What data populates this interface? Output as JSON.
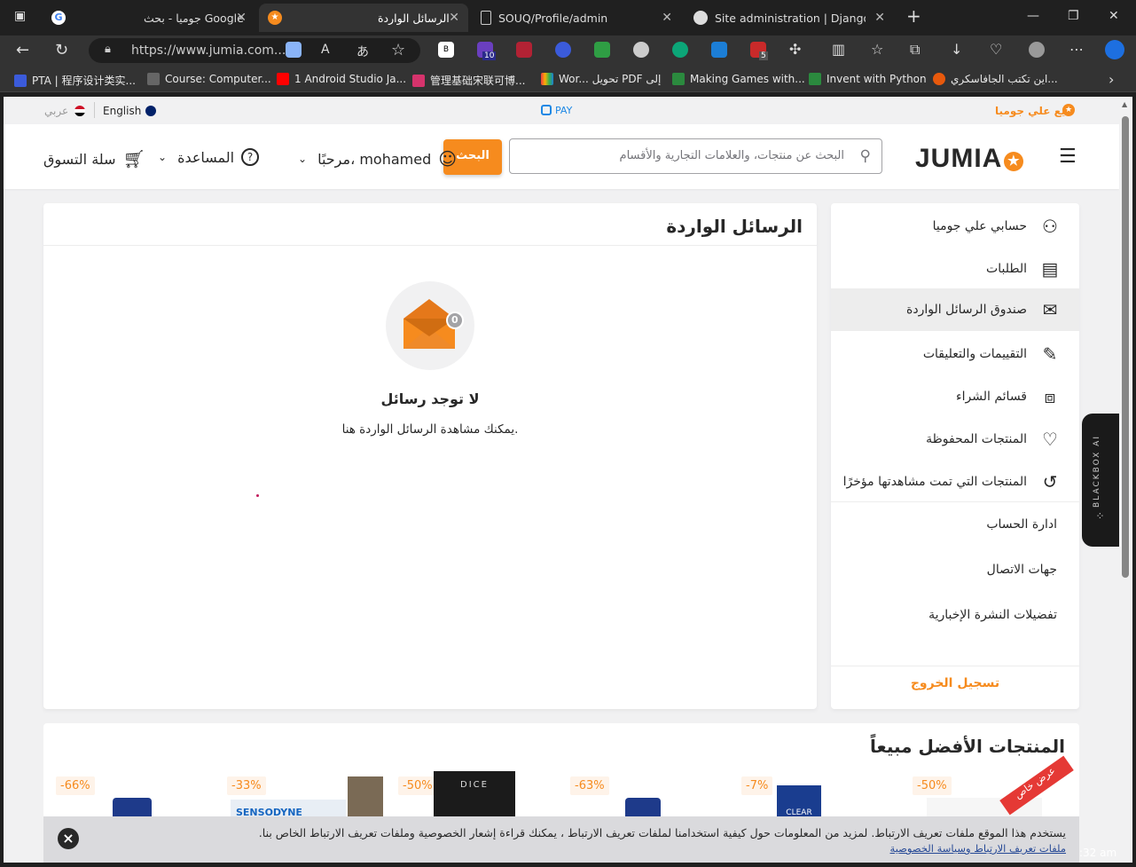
{
  "browser": {
    "tabs": [
      {
        "title": "جوميا - بحث Google",
        "active": false
      },
      {
        "title": "الرسائل الواردة",
        "active": true
      },
      {
        "title": "SOUQ/Profile/admin",
        "active": false
      },
      {
        "title": "Site administration | Django site",
        "active": false
      }
    ],
    "url": "https://www.jumia.com....",
    "bookmarks": [
      "PTA | 程序设计类实...",
      "Course: Computer...",
      "1 Android Studio Ja...",
      "管理基础宋联可博...",
      "Wor... تحويل PDF إلى",
      "Making Games with...",
      "Invent with Python",
      "اين تكتب الجافاسكري..."
    ],
    "ext_badges": {
      "badge1": "10",
      "badge2": "5"
    },
    "time": ":32 am"
  },
  "topstrip": {
    "sell": "بيع علي جوميا",
    "pay": "PAY",
    "lang_en": "English",
    "lang_ar": "عربي"
  },
  "header": {
    "logo": "JUMIA",
    "search_placeholder": "البحث عن منتجات، والعلامات التجارية والأقسام",
    "search_button": "البحث",
    "account": "مرحبًا، mohamed",
    "help": "المساعدة",
    "cart": "سلة التسوق"
  },
  "sidebar": {
    "items": [
      {
        "label": "حسابي علي جوميا",
        "icon": "user-icon"
      },
      {
        "label": "الطلبات",
        "icon": "orders-icon"
      },
      {
        "label": "صندوق الرسائل الواردة",
        "icon": "mail-icon"
      },
      {
        "label": "التقييمات والتعليقات",
        "icon": "review-icon"
      },
      {
        "label": "قسائم الشراء",
        "icon": "voucher-icon"
      },
      {
        "label": "المنتجات المحفوظة",
        "icon": "heart-icon"
      },
      {
        "label": "المنتجات التي تمت مشاهدتها مؤخرًا",
        "icon": "history-icon"
      }
    ],
    "plain": [
      "ادارة الحساب",
      "جهات الاتصال",
      "تفضيلات النشرة الإخبارية"
    ],
    "logout": "تسجيل الخروج"
  },
  "main": {
    "title": "الرسائل الواردة",
    "badge": "0",
    "empty_title": "لا توجد رسائل",
    "empty_sub": "يمكنك مشاهدة الرسائل الواردة هنا."
  },
  "bestsellers": {
    "title": "المنتجات الأفضل مبيعاً",
    "discounts": [
      "-50%",
      "-7%",
      "-63%",
      "-50%",
      "-33%",
      "-66%"
    ],
    "ribbon": "عرض خاص",
    "product_texts": [
      "SENSODYNE",
      "DICE",
      "CLEAR"
    ]
  },
  "cookie": {
    "text": "يستخدم هذا الموقع ملفات تعريف الارتباط. لمزيد من المعلومات حول كيفية استخدامنا لملفات تعريف الارتباط ، يمكنك قراءة إشعار الخصوصية وملفات تعريف الارتباط الخاص بنا.",
    "link": "ملفات تعريف الارتباط وسياسة الخصوصية",
    "close": "×"
  },
  "blackbox": "BLACKBOX AI"
}
